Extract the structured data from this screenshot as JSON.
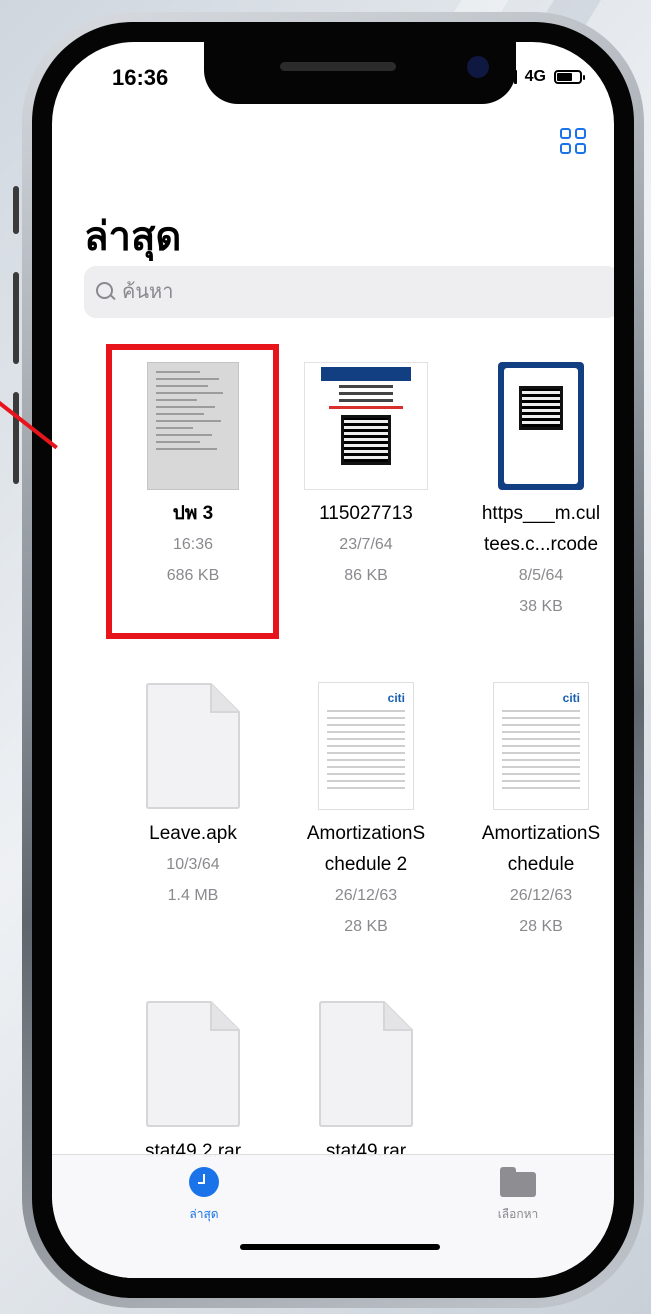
{
  "status_bar": {
    "time": "16:36",
    "network": "4G",
    "battery_level": 0.7
  },
  "header": {
    "title": "ล่าสุด",
    "grid_view_icon": "grid-icon"
  },
  "search": {
    "placeholder": "ค้นหา",
    "value": ""
  },
  "files": [
    {
      "name": "ปพ 3",
      "date": "16:36",
      "size": "686 KB",
      "thumbnail": "document-photo",
      "selected": true
    },
    {
      "name": "115027713",
      "date": "23/7/64",
      "size": "86 KB",
      "thumbnail": "qr-payment-document"
    },
    {
      "name_line1": "https___m.cul",
      "name_line2": "tees.c...rcode",
      "date": "8/5/64",
      "size": "38 KB",
      "thumbnail": "thai-qr-card"
    },
    {
      "name": "Leave.apk",
      "date": "10/3/64",
      "size": "1.4 MB",
      "thumbnail": "generic-file"
    },
    {
      "name_line1": "AmortizationS",
      "name_line2": "chedule 2",
      "date": "26/12/63",
      "size": "28 KB",
      "thumbnail": "citi-spreadsheet",
      "brand": "citi"
    },
    {
      "name_line1": "AmortizationS",
      "name_line2": "chedule",
      "date": "26/12/63",
      "size": "28 KB",
      "thumbnail": "citi-spreadsheet",
      "brand": "citi"
    },
    {
      "name": "stat49 2.rar",
      "thumbnail": "generic-file"
    },
    {
      "name": "stat49.rar",
      "thumbnail": "generic-file"
    }
  ],
  "tabbar": {
    "tabs": [
      {
        "label": "ล่าสุด",
        "icon": "clock-icon",
        "active": true,
        "color": "#1a73e8"
      },
      {
        "label": "เลือกหา",
        "icon": "folder-icon",
        "active": false,
        "color": "#8a8a8e"
      }
    ]
  },
  "colors": {
    "accent": "#1a73e8",
    "highlight": "#e8141c",
    "secondary_text": "#8a8a8e"
  }
}
